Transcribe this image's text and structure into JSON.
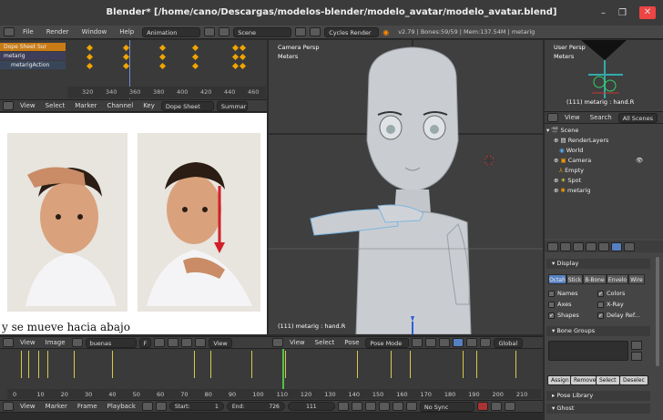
{
  "window": {
    "title": "Blender* [/home/cano/Descargas/modelos-blender/modelo_avatar/modelo_avatar.blend]"
  },
  "menu": {
    "items": [
      "File",
      "Render",
      "Window",
      "Help"
    ],
    "layout": "Animation",
    "scene": "Scene",
    "engine": "Cycles Render",
    "status": "v2.79 | Bones:59/59 | Mem:137.54M | metarig"
  },
  "dopesheet": {
    "channels": [
      "Dope Sheet Sur",
      "metarig",
      "metarigAction"
    ],
    "ticks": [
      "320",
      "340",
      "360",
      "380",
      "400",
      "420",
      "440",
      "460"
    ],
    "header": {
      "view": "View",
      "select": "Select",
      "marker": "Marker",
      "channel": "Channel",
      "key": "Key",
      "mode": "Dope Sheet",
      "summary": "Summar"
    }
  },
  "image_editor": {
    "caption": "y se mueve hacia abajo",
    "header": {
      "view": "View",
      "image": "Image",
      "file": "buenas noches.png",
      "f": "F",
      "view2": "View"
    }
  },
  "viewport": {
    "view_name": "Camera Persp",
    "units": "Meters",
    "selection": "(111) metarig : hand.R",
    "header": {
      "view": "View",
      "select": "Select",
      "pose": "Pose",
      "mode": "Pose Mode",
      "orientation": "Global"
    }
  },
  "mini_view": {
    "view_name": "User Persp",
    "units": "Meters",
    "selection": "(111) metarig : hand.R"
  },
  "outliner": {
    "header": {
      "view": "View",
      "search": "Search",
      "all": "All Scenes"
    },
    "rows": [
      "Scene",
      "RenderLayers",
      "World",
      "Camera",
      "Empty",
      "Spot",
      "metarig"
    ]
  },
  "properties": {
    "display_label": "Display",
    "draw_types": [
      "Octah",
      "Stick",
      "B-Bone",
      "Envelo",
      "Wire"
    ],
    "checks": [
      {
        "label": "Names",
        "checked": false
      },
      {
        "label": "Colors",
        "checked": true
      },
      {
        "label": "Axes",
        "checked": false
      },
      {
        "label": "X-Ray",
        "checked": false
      },
      {
        "label": "Shapes",
        "checked": true
      },
      {
        "label": "Delay Ref...",
        "checked": true
      }
    ],
    "bone_groups_label": "Bone Groups",
    "buttons": [
      "Assign",
      "Remove",
      "Select",
      "Deselec"
    ],
    "pose_library_label": "Pose Library",
    "ghost_label": "Ghost"
  },
  "timeline": {
    "ticks": [
      "0",
      "10",
      "20",
      "30",
      "40",
      "50",
      "60",
      "70",
      "80",
      "90",
      "100",
      "110",
      "120",
      "130",
      "140",
      "150",
      "160",
      "170",
      "180",
      "190",
      "200",
      "210"
    ],
    "markers": [
      2,
      5,
      9,
      13,
      24,
      40,
      74,
      81,
      98,
      112,
      142,
      156,
      164,
      186,
      192,
      208
    ],
    "current": 111,
    "header": {
      "view": "View",
      "marker": "Marker",
      "frame": "Frame",
      "playback": "Playback"
    },
    "start_label": "Start:",
    "start_value": "1",
    "end_label": "End:",
    "end_value": "726",
    "current_value": "111",
    "sync": "No Sync"
  }
}
